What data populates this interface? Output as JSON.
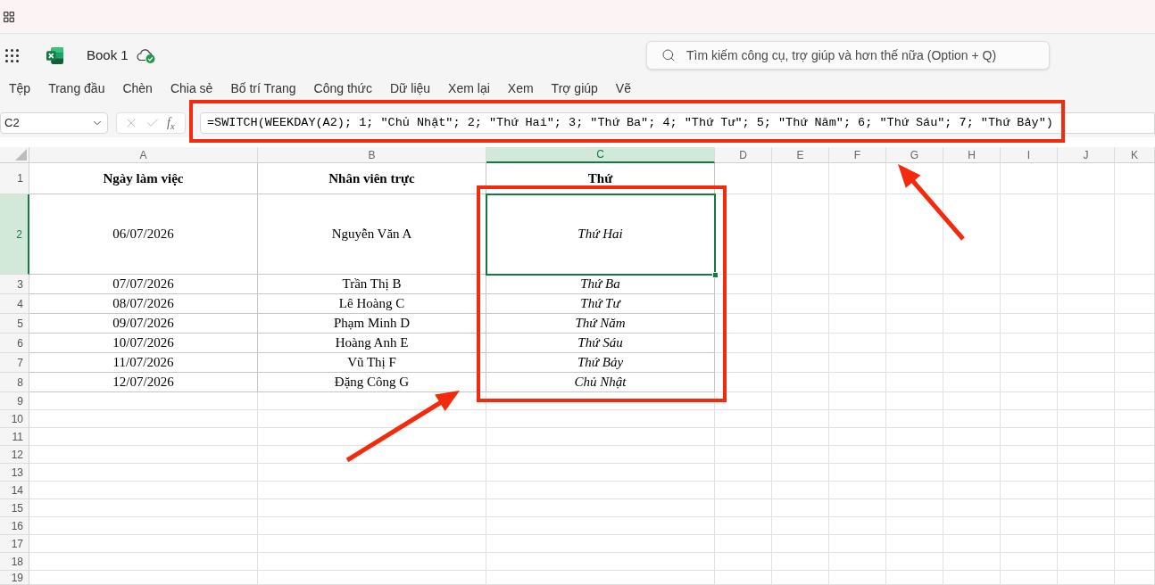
{
  "header": {
    "title": "Book 1",
    "search": {
      "placeholder": "Tìm kiếm công cụ, trợ giúp và hơn thế nữa (Option + Q)"
    }
  },
  "menu": [
    "Tệp",
    "Trang đầu",
    "Chèn",
    "Chia sẻ",
    "Bố trí Trang",
    "Công thức",
    "Dữ liệu",
    "Xem lại",
    "Xem",
    "Trợ giúp",
    "Vẽ"
  ],
  "formula_bar": {
    "name_box": "C2",
    "cancel_button": {
      "disabled": true
    },
    "enter_button": {
      "disabled": true
    },
    "function_button": "f$_{x}$",
    "formula": "=SWITCH(WEEKDAY(A2); 1; \"Chủ Nhật\"; 2; \"Thứ Hai\"; 3; \"Thứ Ba\"; 4; \"Thứ Tư\"; 5; \"Thứ Năm\"; 6; \"Thứ Sáu\"; 7; \"Thứ Bảy\")"
  },
  "sheet": {
    "columns": [
      {
        "label": "A",
        "selected": false
      },
      {
        "label": "B",
        "selected": false
      },
      {
        "label": "C",
        "selected": true
      },
      {
        "label": "D",
        "selected": false
      },
      {
        "label": "E",
        "selected": false
      },
      {
        "label": "F",
        "selected": false
      },
      {
        "label": "G",
        "selected": false
      },
      {
        "label": "H",
        "selected": false
      },
      {
        "label": "I",
        "selected": false
      },
      {
        "label": "J",
        "selected": false
      },
      {
        "label": "K",
        "selected": false
      }
    ],
    "rows": [
      {
        "label": "1",
        "selected": false,
        "kind": "header",
        "cells": [
          {
            "text": "Ngày làm việc",
            "selected": false
          },
          {
            "text": "Nhân viên trực",
            "selected": false
          },
          {
            "text": "Thứ",
            "selected": false
          }
        ]
      },
      {
        "label": "2",
        "selected": true,
        "kind": "record",
        "cells": [
          {
            "text": "06/07/2026",
            "selected": false
          },
          {
            "text": "Nguyễn Văn A",
            "selected": false
          },
          {
            "text": "Thứ Hai",
            "selected": true
          }
        ]
      },
      {
        "label": "3",
        "selected": false,
        "kind": "record",
        "cells": [
          {
            "text": "07/07/2026",
            "selected": false
          },
          {
            "text": "Trần Thị B",
            "selected": false
          },
          {
            "text": "Thứ Ba",
            "selected": false
          }
        ]
      },
      {
        "label": "4",
        "selected": false,
        "kind": "record",
        "cells": [
          {
            "text": "08/07/2026",
            "selected": false
          },
          {
            "text": "Lê Hoàng C",
            "selected": false
          },
          {
            "text": "Thứ Tư",
            "selected": false
          }
        ]
      },
      {
        "label": "5",
        "selected": false,
        "kind": "record",
        "cells": [
          {
            "text": "09/07/2026",
            "selected": false
          },
          {
            "text": "Phạm Minh D",
            "selected": false
          },
          {
            "text": "Thứ Năm",
            "selected": false
          }
        ]
      },
      {
        "label": "6",
        "selected": false,
        "kind": "record",
        "cells": [
          {
            "text": "10/07/2026",
            "selected": false
          },
          {
            "text": "Hoàng Anh E",
            "selected": false
          },
          {
            "text": "Thứ Sáu",
            "selected": false
          }
        ]
      },
      {
        "label": "7",
        "selected": false,
        "kind": "record",
        "cells": [
          {
            "text": "11/07/2026",
            "selected": false
          },
          {
            "text": "Vũ Thị F",
            "selected": false
          },
          {
            "text": "Thứ Bảy",
            "selected": false
          }
        ]
      },
      {
        "label": "8",
        "selected": false,
        "kind": "record",
        "cells": [
          {
            "text": "12/07/2026",
            "selected": false
          },
          {
            "text": "Đặng Công G",
            "selected": false
          },
          {
            "text": "Chủ Nhật",
            "selected": false
          }
        ]
      },
      {
        "label": "9",
        "selected": false,
        "kind": "blank"
      },
      {
        "label": "10",
        "selected": false,
        "kind": "blank"
      },
      {
        "label": "11",
        "selected": false,
        "kind": "blank"
      },
      {
        "label": "12",
        "selected": false,
        "kind": "blank"
      },
      {
        "label": "13",
        "selected": false,
        "kind": "blank"
      },
      {
        "label": "14",
        "selected": false,
        "kind": "blank"
      },
      {
        "label": "15",
        "selected": false,
        "kind": "blank"
      },
      {
        "label": "16",
        "selected": false,
        "kind": "blank"
      },
      {
        "label": "17",
        "selected": false,
        "kind": "blank"
      },
      {
        "label": "18",
        "selected": false,
        "kind": "blank"
      },
      {
        "label": "19",
        "selected": false,
        "kind": "blank"
      }
    ]
  }
}
